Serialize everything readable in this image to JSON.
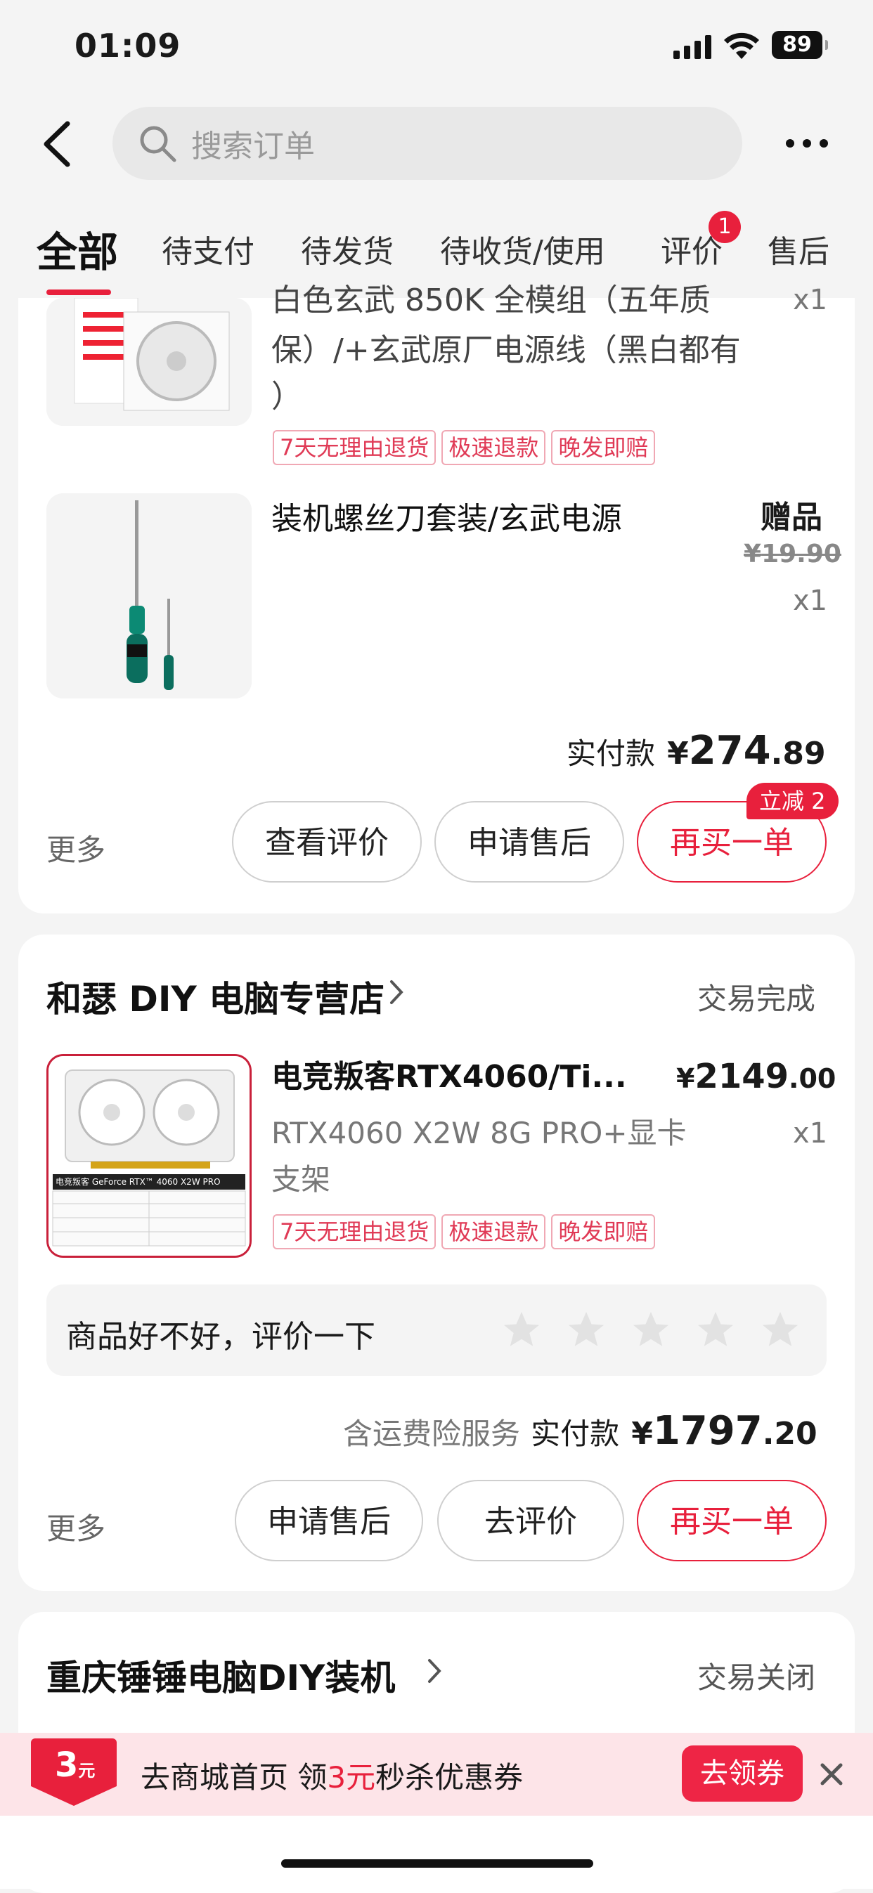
{
  "status_bar": {
    "time": "01:09",
    "battery": "89"
  },
  "header": {
    "search_placeholder": "搜索订单"
  },
  "tabs": [
    {
      "label": "全部",
      "active": true
    },
    {
      "label": "待支付"
    },
    {
      "label": "待发货"
    },
    {
      "label": "待收货/使用"
    },
    {
      "label": "评价",
      "badge": "1"
    },
    {
      "label": "售后"
    }
  ],
  "order1": {
    "item1": {
      "title_line1": "白色玄武 850K 全模组（五年质",
      "title_line2": "保）/+玄武原厂电源线（黑白都有",
      "title_line3": "）",
      "qty": "x1",
      "tags": [
        "7天无理由退货",
        "极速退款",
        "晚发即赔"
      ]
    },
    "item2": {
      "title": "装机螺丝刀套装/玄武电源",
      "price_label": "赠品",
      "orig_price_symbol": "¥",
      "orig_price": "19.90",
      "qty": "x1"
    },
    "paid_label": "实付款",
    "paid_symbol": "¥",
    "paid_int": "274",
    "paid_dec": ".89",
    "more": "更多",
    "buttons": [
      "查看评价",
      "申请售后",
      "再买一单"
    ],
    "discount_badge": "立减 2"
  },
  "order2": {
    "shop_name": "和瑟 DIY 电脑专营店",
    "status": "交易完成",
    "item": {
      "title": "电竞叛客RTX4060/Ti...",
      "price_symbol": "¥",
      "price_int": "2149",
      "price_dec": ".00",
      "sub_line1": "RTX4060 X2W 8G PRO+显卡",
      "sub_line2": "支架",
      "qty": "x1",
      "tags": [
        "7天无理由退货",
        "极速退款",
        "晚发即赔"
      ],
      "box_label": "电竞叛客 GeForce RTX™ 4060 X2W PRO"
    },
    "rate_prompt": "商品好不好，评价一下",
    "insurance": "含运费险服务",
    "paid_label": "实付款",
    "paid_symbol": "¥",
    "paid_int": "1797",
    "paid_dec": ".20",
    "more": "更多",
    "buttons": [
      "申请售后",
      "去评价",
      "再买一单"
    ]
  },
  "order3": {
    "shop_name": "重庆锤锤电脑DIY装机",
    "status": "交易关闭"
  },
  "promo": {
    "coupon_value": "3",
    "coupon_unit": "元",
    "text_pre": "去商城首页 领",
    "amount": "3元",
    "text_post": "秒杀优惠券",
    "button": "去领券"
  },
  "colors": {
    "accent": "#e8203c",
    "tag_border": "#f0a8b4",
    "promo_bg": "#fde4e8"
  }
}
